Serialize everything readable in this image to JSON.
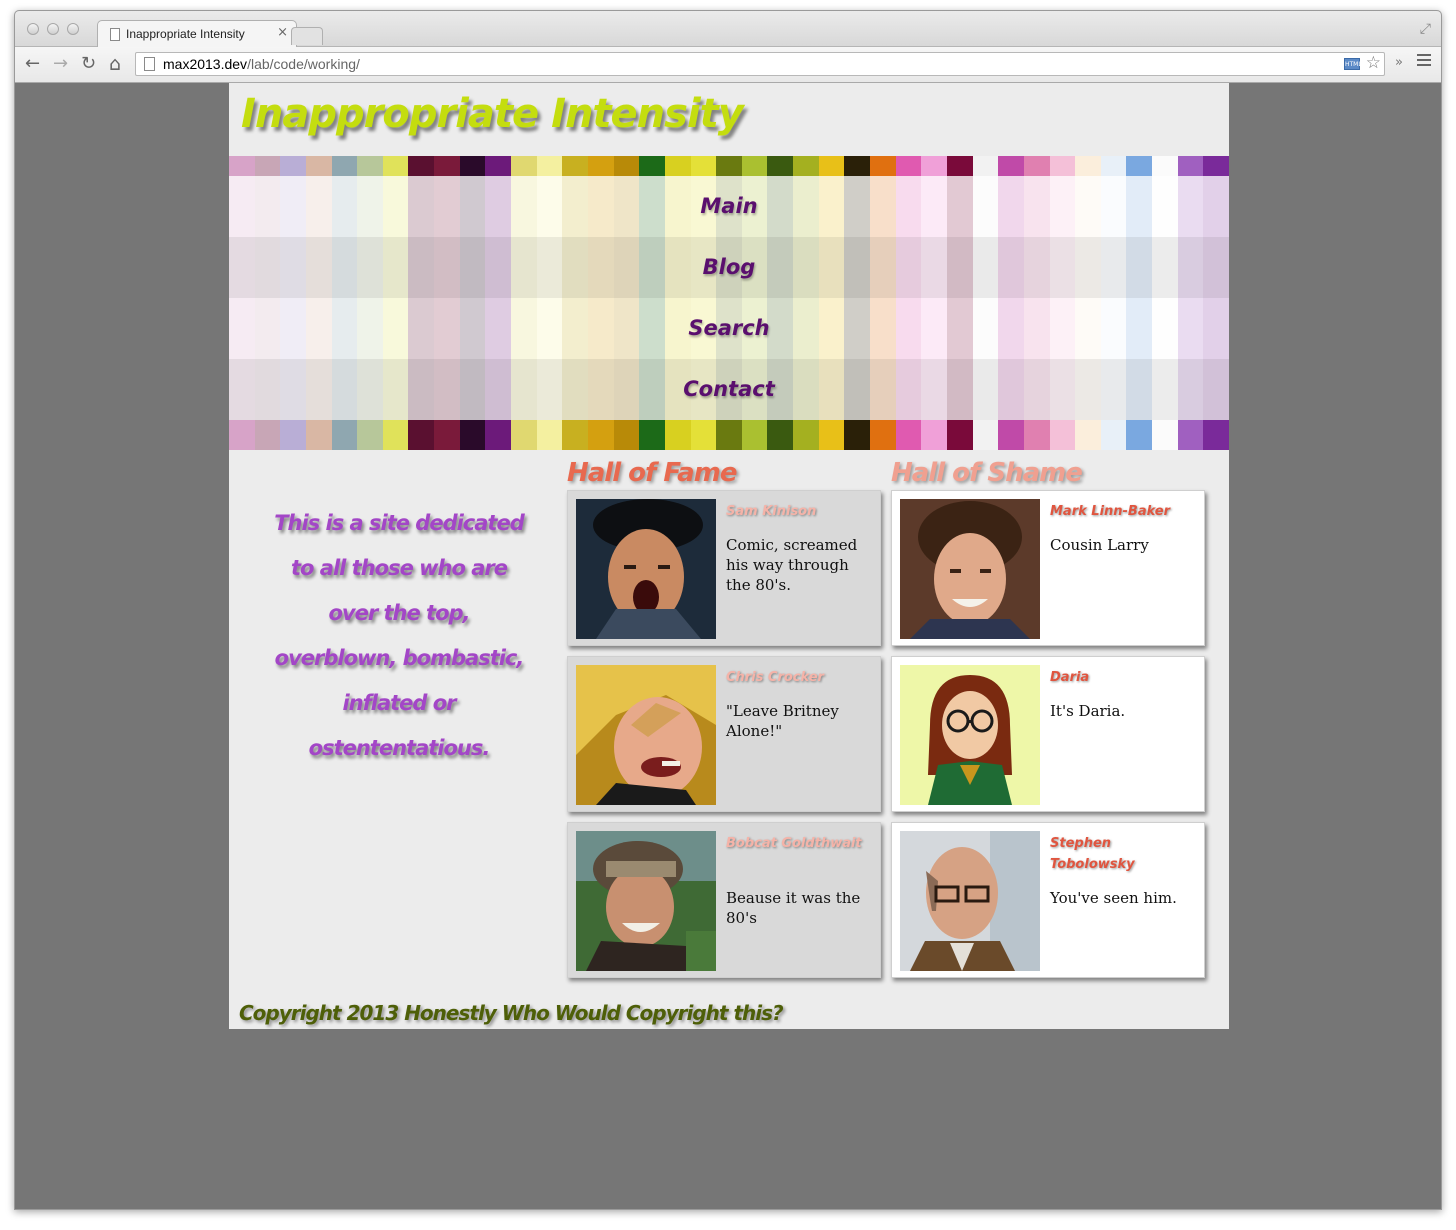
{
  "browser": {
    "tab_title": "Inappropriate Intensity",
    "tab_close": "×",
    "url_host": "max2013.dev",
    "url_path": "/lab/code/working/",
    "back_glyph": "←",
    "forward_glyph": "→",
    "reload_glyph": "↻",
    "home_glyph": "⌂",
    "star_glyph": "☆",
    "chevron_glyph": "»",
    "fullscreen_glyph": "⤢",
    "html5_badge": "HTML"
  },
  "site": {
    "title": "Inappropriate Intensity",
    "nav": [
      "Main",
      "Blog",
      "Search",
      "Contact"
    ],
    "intro": "This is a site dedicated to all those who are over the top, overblown, bombastic, inflated or ostententatious.",
    "footer": "Copyright 2013 Honestly Who Would Copyright this?"
  },
  "hall_of_fame": {
    "title": "Hall of Fame",
    "entries": [
      {
        "name": "Sam Kinison",
        "desc": "Comic, screamed his way through the 80's."
      },
      {
        "name": "Chris Crocker",
        "desc": "\"Leave Britney Alone!\""
      },
      {
        "name": "Bobcat Goldthwait",
        "desc": "Beause it was the 80's"
      }
    ]
  },
  "hall_of_shame": {
    "title": "Hall of Shame",
    "entries": [
      {
        "name": "Mark Linn-Baker",
        "desc": "Cousin Larry"
      },
      {
        "name": "Daria",
        "desc": "It's Daria."
      },
      {
        "name": "Stephen Tobolowsky",
        "desc": "You've seen him."
      }
    ]
  },
  "colors": {
    "title_green": "#c4dd0f",
    "nav_purple": "#5a0f6e",
    "intro_purple": "#a346c7",
    "fame_red": "#e8694f",
    "shame_salmon": "#f0a090",
    "footer_olive": "#4e5f08",
    "page_bg": "#ececec",
    "window_bg": "#767676"
  }
}
